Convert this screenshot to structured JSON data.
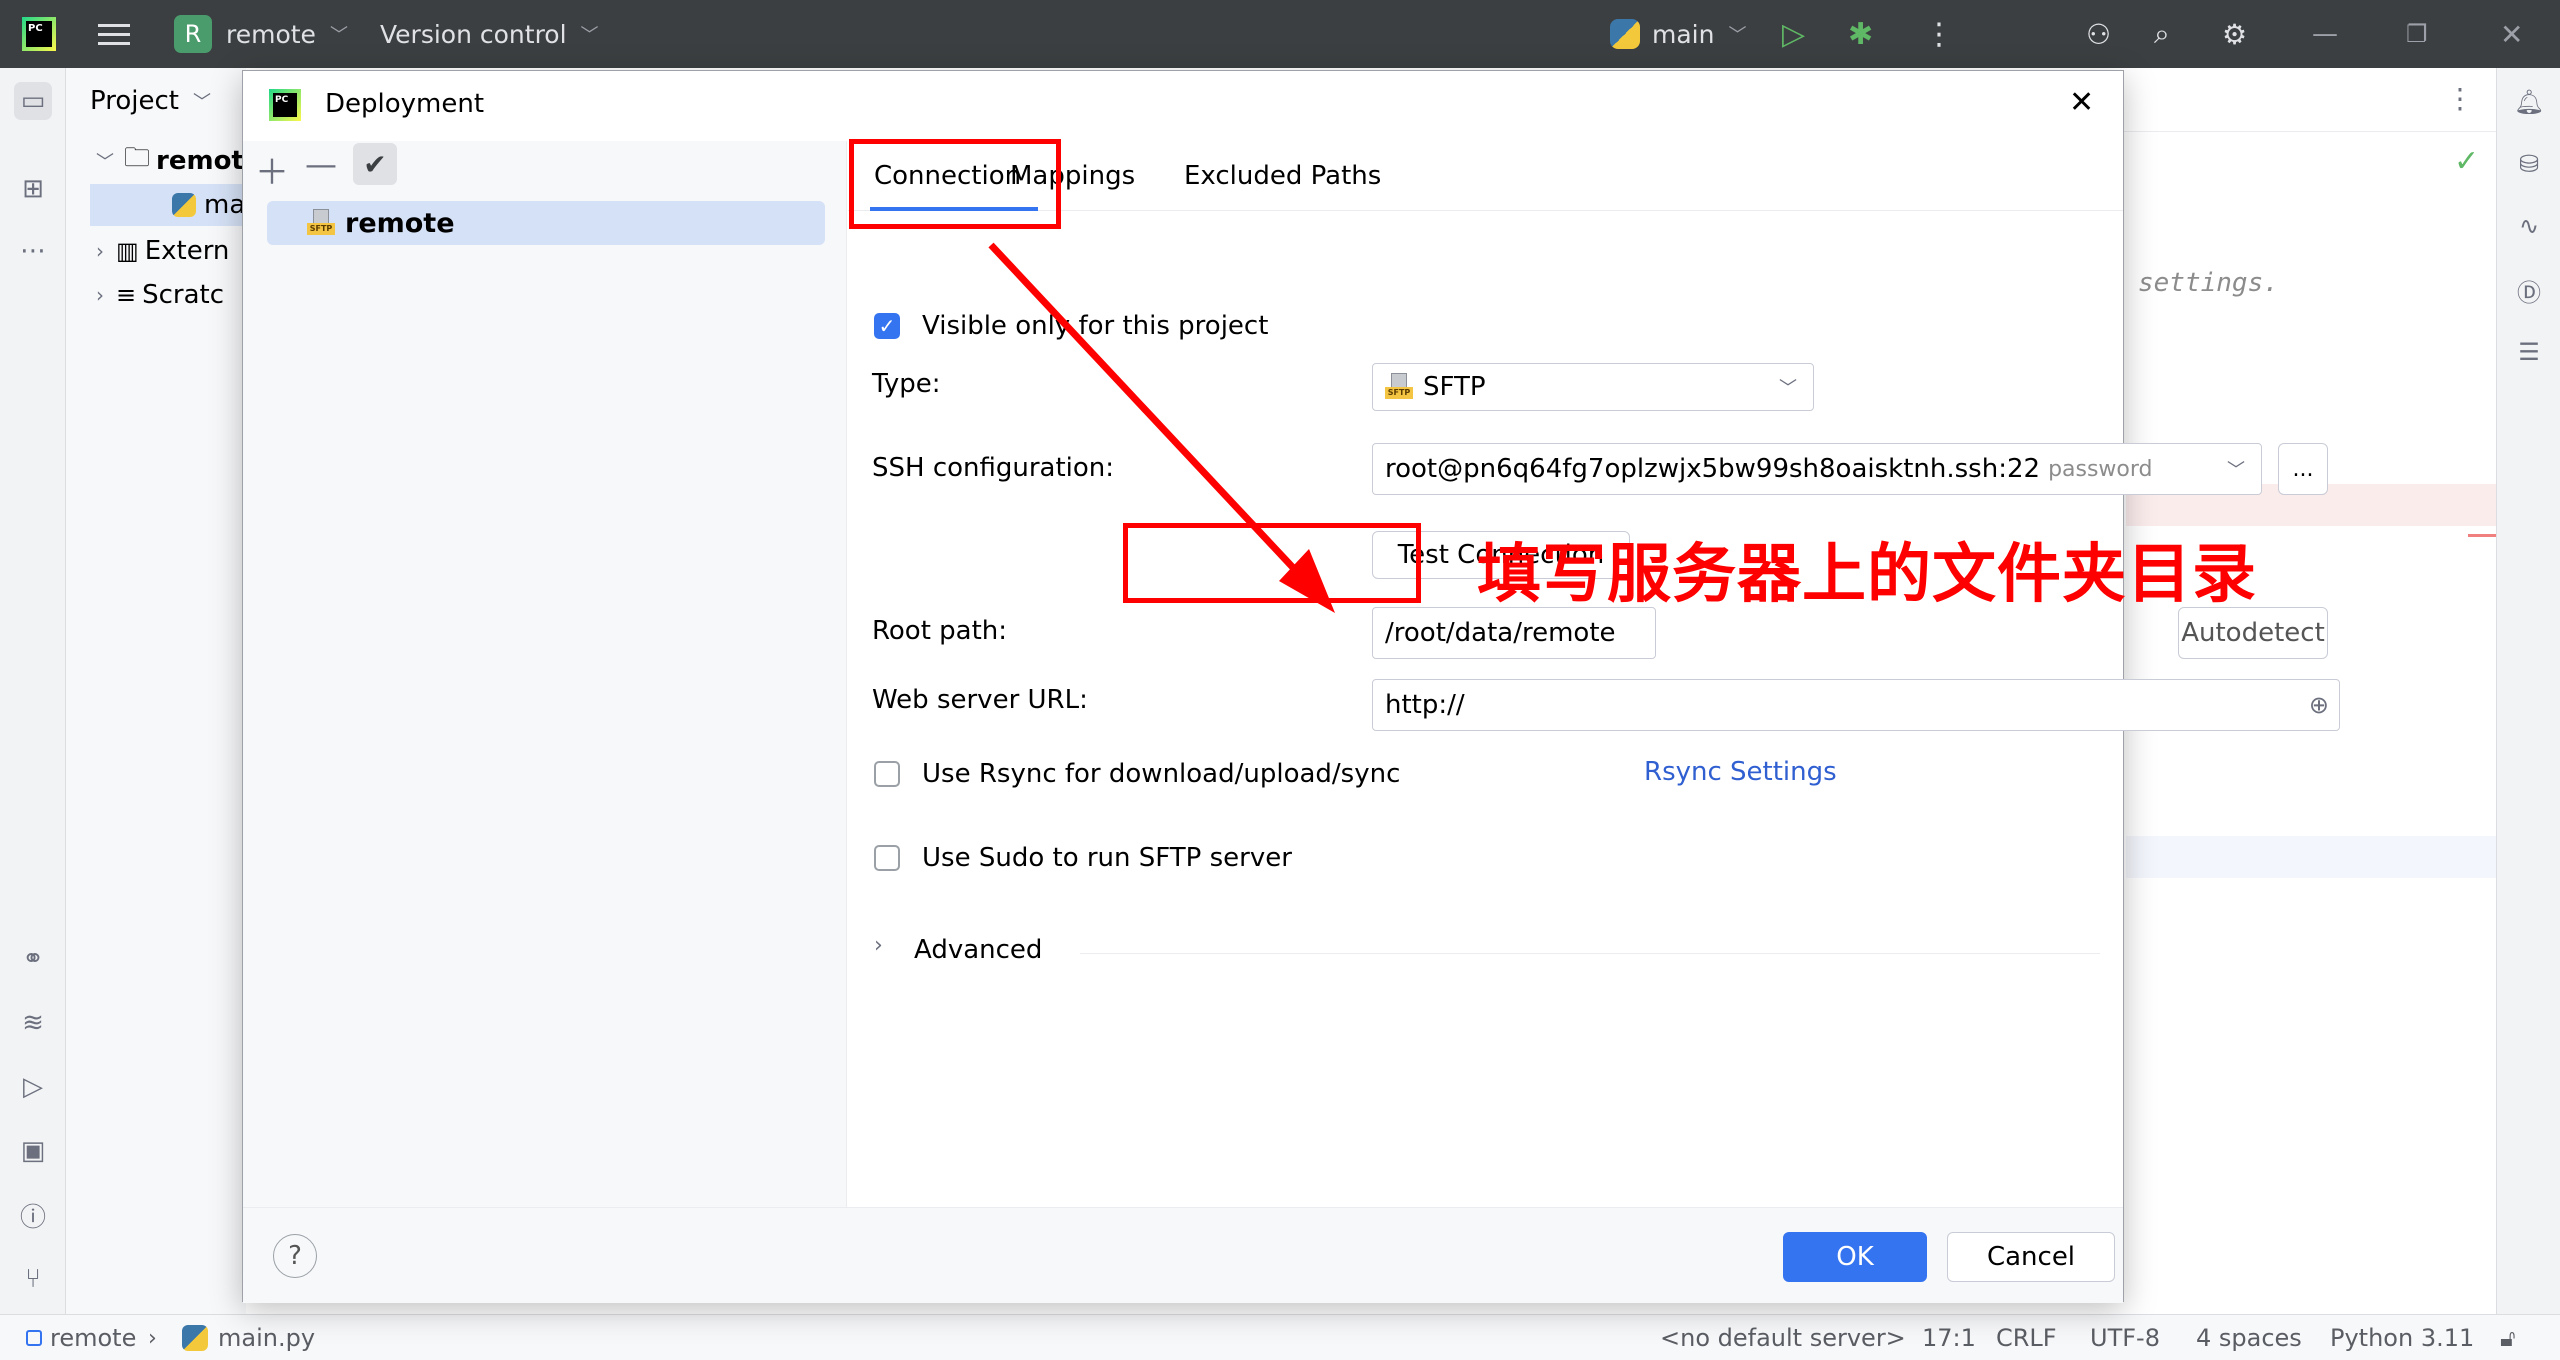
{
  "titlebar": {
    "project_badge": "R",
    "project_name": "remote",
    "vcs": "Version control",
    "run_config": "main"
  },
  "project_panel": {
    "header": "Project",
    "tree": [
      "remot",
      "ma",
      "Extern",
      "Scratc"
    ]
  },
  "editor": {
    "hint_text": "settings."
  },
  "dialog": {
    "title": "Deployment",
    "server_name": "remote",
    "tabs": [
      "Connection",
      "Mappings",
      "Excluded Paths"
    ],
    "visible_only_label": "Visible only for this project",
    "type_label": "Type:",
    "type_value": "SFTP",
    "ssh_label": "SSH configuration:",
    "ssh_value": "root@pn6q64fg7oplzwjx5bw99sh8oaisktnh.ssh:22",
    "ssh_auth": "password",
    "ssh_more": "...",
    "test_connection": "Test Connection",
    "root_path_label": "Root path:",
    "root_path_value": "/root/data/remote",
    "autodetect": "Autodetect",
    "web_url_label": "Web server URL:",
    "web_url_value": "http://",
    "rsync_label": "Use Rsync for download/upload/sync",
    "rsync_settings": "Rsync Settings",
    "sudo_label": "Use Sudo to run SFTP server",
    "advanced": "Advanced",
    "help": "?",
    "ok": "OK",
    "cancel": "Cancel"
  },
  "annotation": {
    "text": "填写服务器上的文件夹目录",
    "color": "#ff0000"
  },
  "statusbar": {
    "project": "remote",
    "file": "main.py",
    "server": "<no default server>",
    "position": "17:1",
    "line_sep": "CRLF",
    "encoding": "UTF-8",
    "indent": "4 spaces",
    "interpreter": "Python 3.11"
  },
  "colors": {
    "accent": "#3574f0",
    "titlebar": "#3c3f41",
    "annotation_red": "#ff0000",
    "link": "#2f5fd0"
  }
}
